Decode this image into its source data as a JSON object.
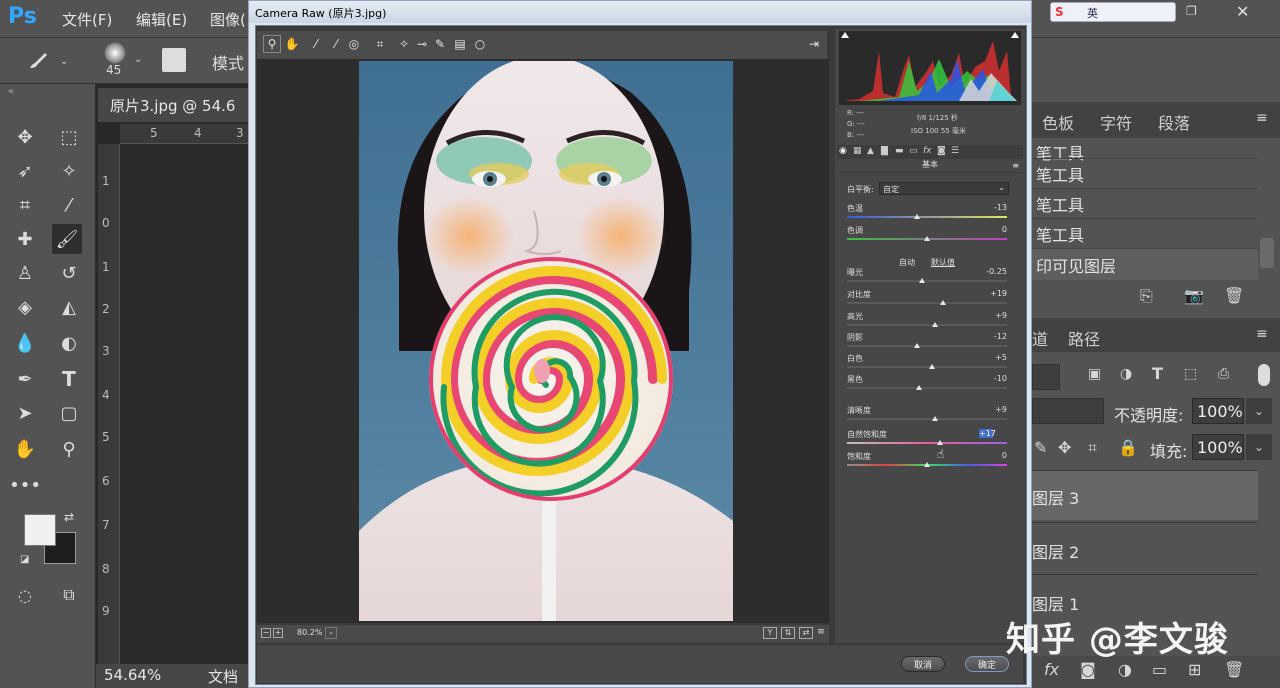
{
  "app": {
    "logo": "Ps",
    "menus": [
      "文件(F)",
      "编辑(E)",
      "图像("
    ],
    "ime_label": "英"
  },
  "options_bar": {
    "brush_size": "45",
    "mode_label": "模式"
  },
  "document": {
    "tab_title": "原片3.jpg @ 54.6",
    "zoom_status": "54.64%",
    "status_label": "文档",
    "ruler_h_ticks": [
      "5",
      "4",
      "3"
    ],
    "ruler_v_ticks": [
      "1",
      "0",
      "1",
      "2",
      "3",
      "4",
      "5",
      "6",
      "7",
      "8",
      "9"
    ]
  },
  "camera_raw": {
    "title": "Camera Raw (原片3.jpg)",
    "zoom_level": "80.2%",
    "camera_info": {
      "r": "R:  ---",
      "g": "G:  ---",
      "b": "B:  ---",
      "aperture_shutter": "f/8   1/125 秒",
      "iso_focal": "ISO 100   55 毫米"
    },
    "panel_title": "基本",
    "white_balance_label": "白平衡:",
    "white_balance_value": "自定",
    "auto_label": "自动",
    "default_label": "默认值",
    "sliders": [
      {
        "label": "色温",
        "value": "-13",
        "pos": 0.44
      },
      {
        "label": "色调",
        "value": "0",
        "pos": 0.5
      },
      {
        "label": "曝光",
        "value": "-0.25",
        "pos": 0.47
      },
      {
        "label": "对比度",
        "value": "+19",
        "pos": 0.6
      },
      {
        "label": "高光",
        "value": "+9",
        "pos": 0.55
      },
      {
        "label": "阴影",
        "value": "-12",
        "pos": 0.44
      },
      {
        "label": "白色",
        "value": "+5",
        "pos": 0.53
      },
      {
        "label": "黑色",
        "value": "-10",
        "pos": 0.45
      },
      {
        "label": "清晰度",
        "value": "+9",
        "pos": 0.55
      },
      {
        "label": "自然饱和度",
        "value": "+17",
        "pos": 0.58
      },
      {
        "label": "饱和度",
        "value": "0",
        "pos": 0.5
      }
    ],
    "cancel_label": "取消",
    "ok_label": "确定"
  },
  "right_panels": {
    "top_tabs": [
      "色板",
      "字符",
      "段落"
    ],
    "history_items": [
      "笔工具",
      "笔工具",
      "笔工具",
      "印可见图层"
    ],
    "mid_tabs": [
      "道",
      "路径"
    ],
    "opacity_label": "不透明度:",
    "opacity_value": "100%",
    "fill_label": "填充:",
    "fill_value": "100%",
    "layers": [
      "图层 3",
      "图层 2",
      "图层 1"
    ]
  },
  "watermark": "知乎 @李文骏",
  "colors": {
    "ps_blue": "#31a8ff",
    "panel_bg": "#535353",
    "cr_panel": "#474747"
  }
}
